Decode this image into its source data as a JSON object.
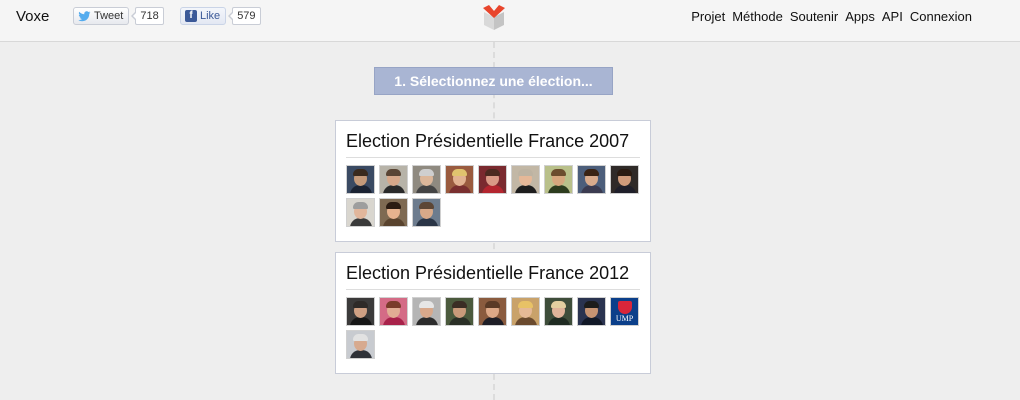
{
  "header": {
    "brand": "Voxe",
    "tweet_label": "Tweet",
    "tweet_count": "718",
    "like_label": "Like",
    "like_count": "579",
    "logo_icon": "voxe-logo-icon",
    "nav": [
      "Projet",
      "Méthode",
      "Soutenir",
      "Apps",
      "API",
      "Connexion"
    ]
  },
  "step": {
    "label": "1. Sélectionnez une élection..."
  },
  "elections": [
    {
      "title": "Election Présidentielle France 2007",
      "candidates": [
        {
          "bg": "#3a4a63",
          "skin": "#c59a7a",
          "hair": "#3a2a1e",
          "suit": "#1b2333"
        },
        {
          "bg": "#b7b3a8",
          "skin": "#d7a88a",
          "hair": "#5a4535",
          "suit": "#2a2a2a"
        },
        {
          "bg": "#8f8a80",
          "skin": "#dcb79a",
          "hair": "#cfcfcf",
          "suit": "#444444"
        },
        {
          "bg": "#9a5b3f",
          "skin": "#e2b291",
          "hair": "#e0c36e",
          "suit": "#7a2f2f"
        },
        {
          "bg": "#7a2a2f",
          "skin": "#d99a86",
          "hair": "#4b2a20",
          "suit": "#b4262f"
        },
        {
          "bg": "#c2b7a5",
          "skin": "#e5b898",
          "hair": "#bdb3a2",
          "suit": "#1d1d1d"
        },
        {
          "bg": "#b9c08a",
          "skin": "#d6a77e",
          "hair": "#6b4d2e",
          "suit": "#2d3c1e"
        },
        {
          "bg": "#4c5e7b",
          "skin": "#d9ab8c",
          "hair": "#3a2314",
          "suit": "#3b3b50"
        },
        {
          "bg": "#2f2a28",
          "skin": "#cf9b7b",
          "hair": "#2a1b12",
          "suit": "#1f1f2a"
        },
        {
          "bg": "#d9d6cf",
          "skin": "#e1b69b",
          "hair": "#9e9e9e",
          "suit": "#3a3a3a"
        },
        {
          "bg": "#7e6a52",
          "skin": "#e6b38f",
          "hair": "#2b1c12",
          "suit": "#59432e"
        },
        {
          "bg": "#6d7c8e",
          "skin": "#d8a989",
          "hair": "#5c4636",
          "suit": "#2a3546"
        }
      ]
    },
    {
      "title": "Election Présidentielle France 2012",
      "candidates": [
        {
          "bg": "#3b3a3a",
          "skin": "#cfa083",
          "hair": "#2e2a28",
          "suit": "#171717"
        },
        {
          "bg": "#d46b86",
          "skin": "#e1ad94",
          "hair": "#7a3b2a",
          "suit": "#a8224a"
        },
        {
          "bg": "#b5b5b5",
          "skin": "#d8a88b",
          "hair": "#e6e6e6",
          "suit": "#2c2c2c"
        },
        {
          "bg": "#4b5a3d",
          "skin": "#c99a7a",
          "hair": "#3a2d24",
          "suit": "#2a2f26"
        },
        {
          "bg": "#8a5b3e",
          "skin": "#dca887",
          "hair": "#5a3a26",
          "suit": "#1e1e26"
        },
        {
          "bg": "#c9a26a",
          "skin": "#e5b996",
          "hair": "#e8c266",
          "suit": "#6a4a2e"
        },
        {
          "bg": "#3e4d3a",
          "skin": "#e0b49a",
          "hair": "#e3cfa0",
          "suit": "#1f2b22"
        },
        {
          "bg": "#2a3350",
          "skin": "#c69372",
          "hair": "#1c1c1c",
          "suit": "#111827"
        },
        {
          "type": "ump",
          "label": "UMP"
        },
        {
          "bg": "#c8cbd0",
          "skin": "#d7aa8f",
          "hair": "#e2e2e2",
          "suit": "#2f3238"
        }
      ]
    }
  ]
}
